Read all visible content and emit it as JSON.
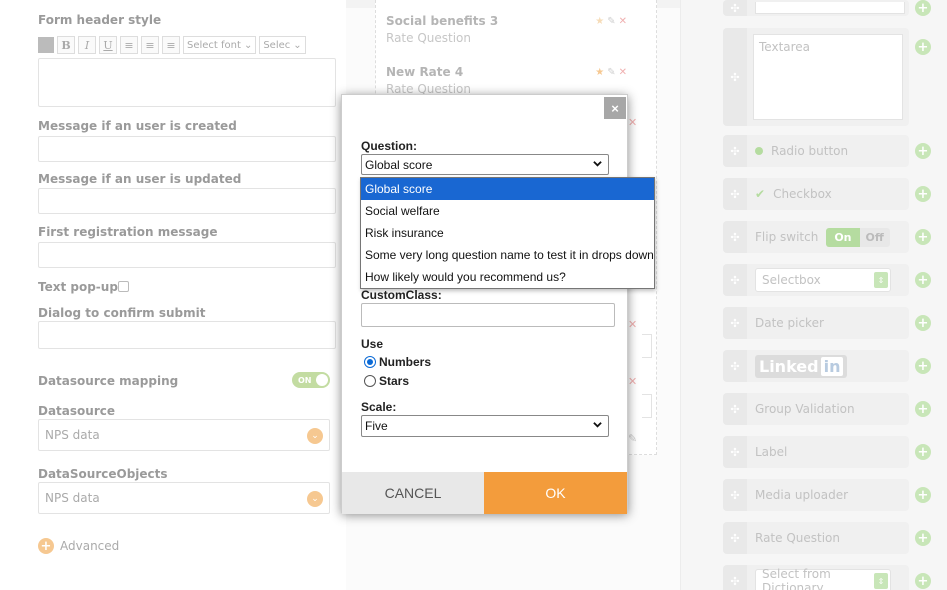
{
  "left_form": {
    "form_header_style_label": "Form header style",
    "toolbar": {
      "bold": "B",
      "italic": "I",
      "underline": "U",
      "font_select": "Select font",
      "size_select": "Selec"
    },
    "message_created_label": "Message if an user is created",
    "message_updated_label": "Message if an user is updated",
    "first_registration_label": "First registration message",
    "text_popup_label": "Text pop-up",
    "dialog_confirm_label": "Dialog to confirm submit",
    "datasource_mapping_label": "Datasource mapping",
    "datasource_mapping_toggle": "ON",
    "datasource_label": "Datasource",
    "datasource_value": "NPS data",
    "datasource_objects_label": "DataSourceObjects",
    "datasource_objects_value": "NPS data",
    "advanced_label": "Advanced"
  },
  "middle_list": {
    "items": [
      {
        "title": "Social benefits 3",
        "subtitle": "Rate Question"
      },
      {
        "title": "New Rate 4",
        "subtitle": "Rate Question"
      }
    ]
  },
  "palette": {
    "items": [
      {
        "label": "Textarea"
      },
      {
        "label": "Radio button"
      },
      {
        "label": "Checkbox"
      },
      {
        "label": "Flip switch",
        "on": "On",
        "off": "Off"
      },
      {
        "label": "Selectbox"
      },
      {
        "label": "Date picker"
      },
      {
        "label": "Linked",
        "badge": "in"
      },
      {
        "label": "Group Validation"
      },
      {
        "label": "Label"
      },
      {
        "label": "Media uploader"
      },
      {
        "label": "Rate Question"
      },
      {
        "label": "Select from Dictionary"
      }
    ]
  },
  "modal": {
    "close": "×",
    "question_label": "Question:",
    "question_value": "Global score",
    "question_options": [
      "Global score",
      "Social welfare",
      "Risk insurance",
      "Some very long question name to test it in drops down",
      "How likely would you recommend us?"
    ],
    "custom_class_label": "CustomClass:",
    "custom_class_value": "",
    "use_label": "Use",
    "use_options": [
      "Numbers",
      "Stars"
    ],
    "use_selected": "Numbers",
    "scale_label": "Scale:",
    "scale_value": "Five",
    "cancel": "CANCEL",
    "ok": "OK"
  },
  "colors": {
    "accent_orange": "#f39c3c",
    "select_blue": "#1967d2",
    "palette_green": "#c8e6b8"
  }
}
